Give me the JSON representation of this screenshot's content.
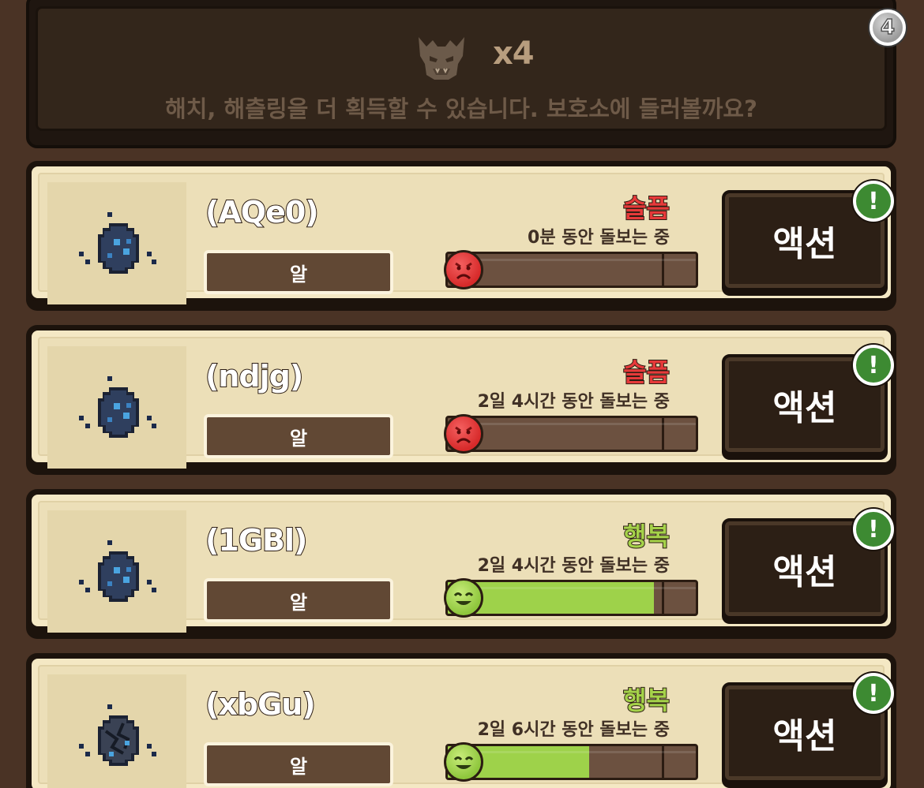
{
  "header": {
    "count_text": "x4",
    "message": "해치, 해츨링을 더 획득할 수 있습니다. 보호소에 들러볼까요?",
    "badge_count": "4"
  },
  "pets": [
    {
      "name": "(AQe0)",
      "stage": "알",
      "mood": "슬픔",
      "mood_type": "sad",
      "care_time": "0분 동안 돌보는 중",
      "happiness": 0,
      "action_label": "액션",
      "alert": "!"
    },
    {
      "name": "(ndjg)",
      "stage": "알",
      "mood": "슬픔",
      "mood_type": "sad",
      "care_time": "2일 4시간 동안 돌보는 중",
      "happiness": 0,
      "action_label": "액션",
      "alert": "!"
    },
    {
      "name": "(1GBl)",
      "stage": "알",
      "mood": "행복",
      "mood_type": "happy",
      "care_time": "2일 4시간 동안 돌보는 중",
      "happiness": 0.83,
      "action_label": "액션",
      "alert": "!"
    },
    {
      "name": "(xbGu)",
      "stage": "알",
      "mood": "행복",
      "mood_type": "happy",
      "care_time": "2일 6시간 동안 돌보는 중",
      "happiness": 0.57,
      "action_label": "액션",
      "alert": "!"
    }
  ],
  "colors": {
    "sad": "#e63a3a",
    "happy": "#a5d24a",
    "bar_fill": "#9ed24a",
    "alert_badge": "#3d8a32"
  }
}
